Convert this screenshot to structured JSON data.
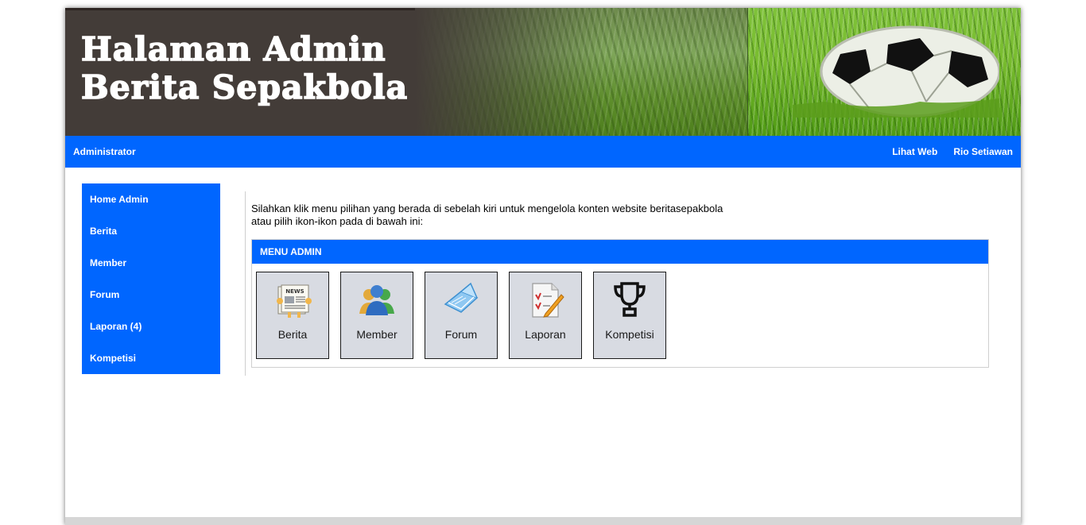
{
  "banner": {
    "title_line1": "Halaman Admin",
    "title_line2": "Berita Sepakbola"
  },
  "navbar": {
    "brand": "Administrator",
    "links": [
      "Lihat Web",
      "Rio Setiawan"
    ]
  },
  "sidebar": {
    "items": [
      {
        "label": "Home Admin"
      },
      {
        "label": "Berita"
      },
      {
        "label": "Member"
      },
      {
        "label": "Forum"
      },
      {
        "label": "Laporan (4)"
      },
      {
        "label": "Kompetisi"
      }
    ]
  },
  "main": {
    "intro_line1": "Silahkan klik menu pilihan yang berada di sebelah kiri untuk mengelola konten website beritasepakbola",
    "intro_line2": "atau pilih ikon-ikon pada di bawah ini:",
    "panel_title": "MENU ADMIN",
    "tiles": [
      {
        "label": "Berita",
        "icon": "newspaper-icon"
      },
      {
        "label": "Member",
        "icon": "users-icon"
      },
      {
        "label": "Forum",
        "icon": "book-icon"
      },
      {
        "label": "Laporan",
        "icon": "report-icon"
      },
      {
        "label": "Kompetisi",
        "icon": "trophy-icon"
      }
    ]
  },
  "colors": {
    "accent": "#0066ff",
    "tile_bg": "#d8dbe2",
    "banner_dark": "#433c38"
  }
}
